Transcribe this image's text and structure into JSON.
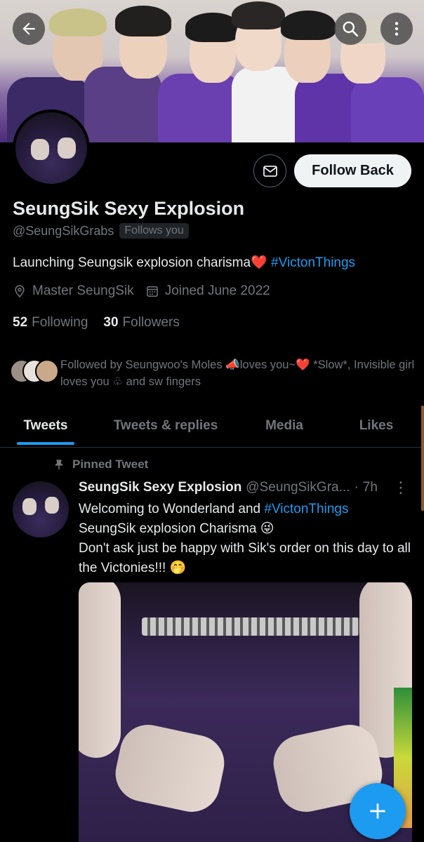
{
  "header": {
    "back_icon": "arrow-left-icon",
    "search_icon": "search-icon",
    "more_icon": "more-vertical-icon"
  },
  "profile": {
    "display_name": "SeungSik Sexy Explosion",
    "handle": "@SeungSikGrabs",
    "follows_you": "Follows you",
    "bio_text": "Launching Seungsik explosion charisma",
    "bio_emoji": "❤️",
    "bio_hashtag": "#VictonThings",
    "location": "Master SeungSik",
    "joined": "Joined June 2022",
    "following_count": "52",
    "following_label": "Following",
    "followers_count": "30",
    "followers_label": "Followers",
    "followed_by": "Followed by Seungwoo's Moles 📣loves you~❤️ *Slow*, Invisible girl loves you ♧ and sw fingers"
  },
  "actions": {
    "message_icon": "mail-icon",
    "follow_back_label": "Follow Back"
  },
  "tabs": [
    {
      "label": "Tweets",
      "active": true
    },
    {
      "label": "Tweets & replies",
      "active": false
    },
    {
      "label": "Media",
      "active": false
    },
    {
      "label": "Likes",
      "active": false
    }
  ],
  "tweet": {
    "pinned_label": "Pinned Tweet",
    "author_name": "SeungSik Sexy Explosion",
    "author_handle": "@SeungSikGra...",
    "dot": "·",
    "time": "7h",
    "line1_text": "Welcoming to Wonderland and ",
    "line1_hashtag": "#VictonThings",
    "line2": "SeungSik explosion Charisma 😜",
    "line3": "Don't ask just be happy with Sik's order on this day to all the Victonies!!! 🤭"
  },
  "fab": {
    "icon": "plus-icon"
  },
  "colors": {
    "accent": "#1d9bf0",
    "background": "#000000",
    "muted_text": "#71767b",
    "primary_text": "#e7e9ea"
  }
}
